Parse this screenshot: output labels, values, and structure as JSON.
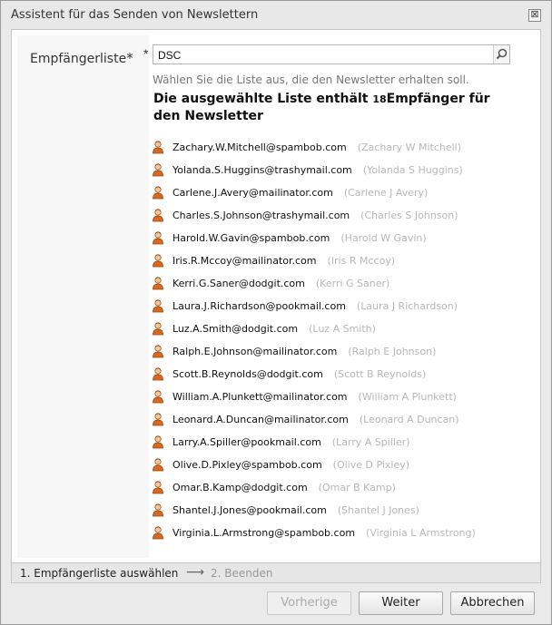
{
  "window": {
    "title": "Assistent für das Senden von Newslettern",
    "close_symbol": "⊠"
  },
  "form": {
    "label": "Empfängerliste",
    "label_required_mark": "*",
    "required_star": "*",
    "search_value": "DSC",
    "hint": "Wählen Sie die Liste aus, die den Newsletter erhalten soll.",
    "summary_prefix": "Die ausgewählte Liste enthält ",
    "summary_count": "18",
    "summary_suffix": "Empfänger für den Newsletter"
  },
  "recipients": [
    {
      "email": "Zachary.W.Mitchell@spambob.com",
      "name": "(Zachary W Mitchell)"
    },
    {
      "email": "Yolanda.S.Huggins@trashymail.com",
      "name": "(Yolanda S Huggins)"
    },
    {
      "email": "Carlene.J.Avery@mailinator.com",
      "name": "(Carlene J Avery)"
    },
    {
      "email": "Charles.S.Johnson@trashymail.com",
      "name": "(Charles S Johnson)"
    },
    {
      "email": "Harold.W.Gavin@spambob.com",
      "name": "(Harold W Gavin)"
    },
    {
      "email": "Iris.R.Mccoy@mailinator.com",
      "name": "(Iris R Mccoy)"
    },
    {
      "email": "Kerri.G.Saner@dodgit.com",
      "name": "(Kerri G Saner)"
    },
    {
      "email": "Laura.J.Richardson@pookmail.com",
      "name": "(Laura J Richardson)"
    },
    {
      "email": "Luz.A.Smith@dodgit.com",
      "name": "(Luz A Smith)"
    },
    {
      "email": "Ralph.E.Johnson@mailinator.com",
      "name": "(Ralph E Johnson)"
    },
    {
      "email": "Scott.B.Reynolds@dodgit.com",
      "name": "(Scott B Reynolds)"
    },
    {
      "email": "William.A.Plunkett@mailinator.com",
      "name": "(William A Plunkett)"
    },
    {
      "email": "Leonard.A.Duncan@mailinator.com",
      "name": "(Leonard A Duncan)"
    },
    {
      "email": "Larry.A.Spiller@pookmail.com",
      "name": "(Larry A Spiller)"
    },
    {
      "email": "Olive.D.Pixley@spambob.com",
      "name": "(Olive D Pixley)"
    },
    {
      "email": "Omar.B.Kamp@dodgit.com",
      "name": "(Omar B Kamp)"
    },
    {
      "email": "Shantel.J.Jones@pookmail.com",
      "name": "(Shantel J Jones)"
    },
    {
      "email": "Virginia.L.Armstrong@spambob.com",
      "name": "(Virginia L Armstrong)"
    }
  ],
  "steps": {
    "step1": "1. Empfängerliste auswählen",
    "arrow": "⟶",
    "step2": "2. Beenden"
  },
  "buttons": {
    "prev": "Vorherige",
    "next": "Weiter",
    "cancel": "Abbrechen"
  },
  "icons": {
    "search": "magnifier-icon",
    "person": "person-icon"
  },
  "colors": {
    "icon_orange": "#d9691f",
    "icon_skin": "#f1c89a",
    "muted_text": "#b7b7b7"
  }
}
